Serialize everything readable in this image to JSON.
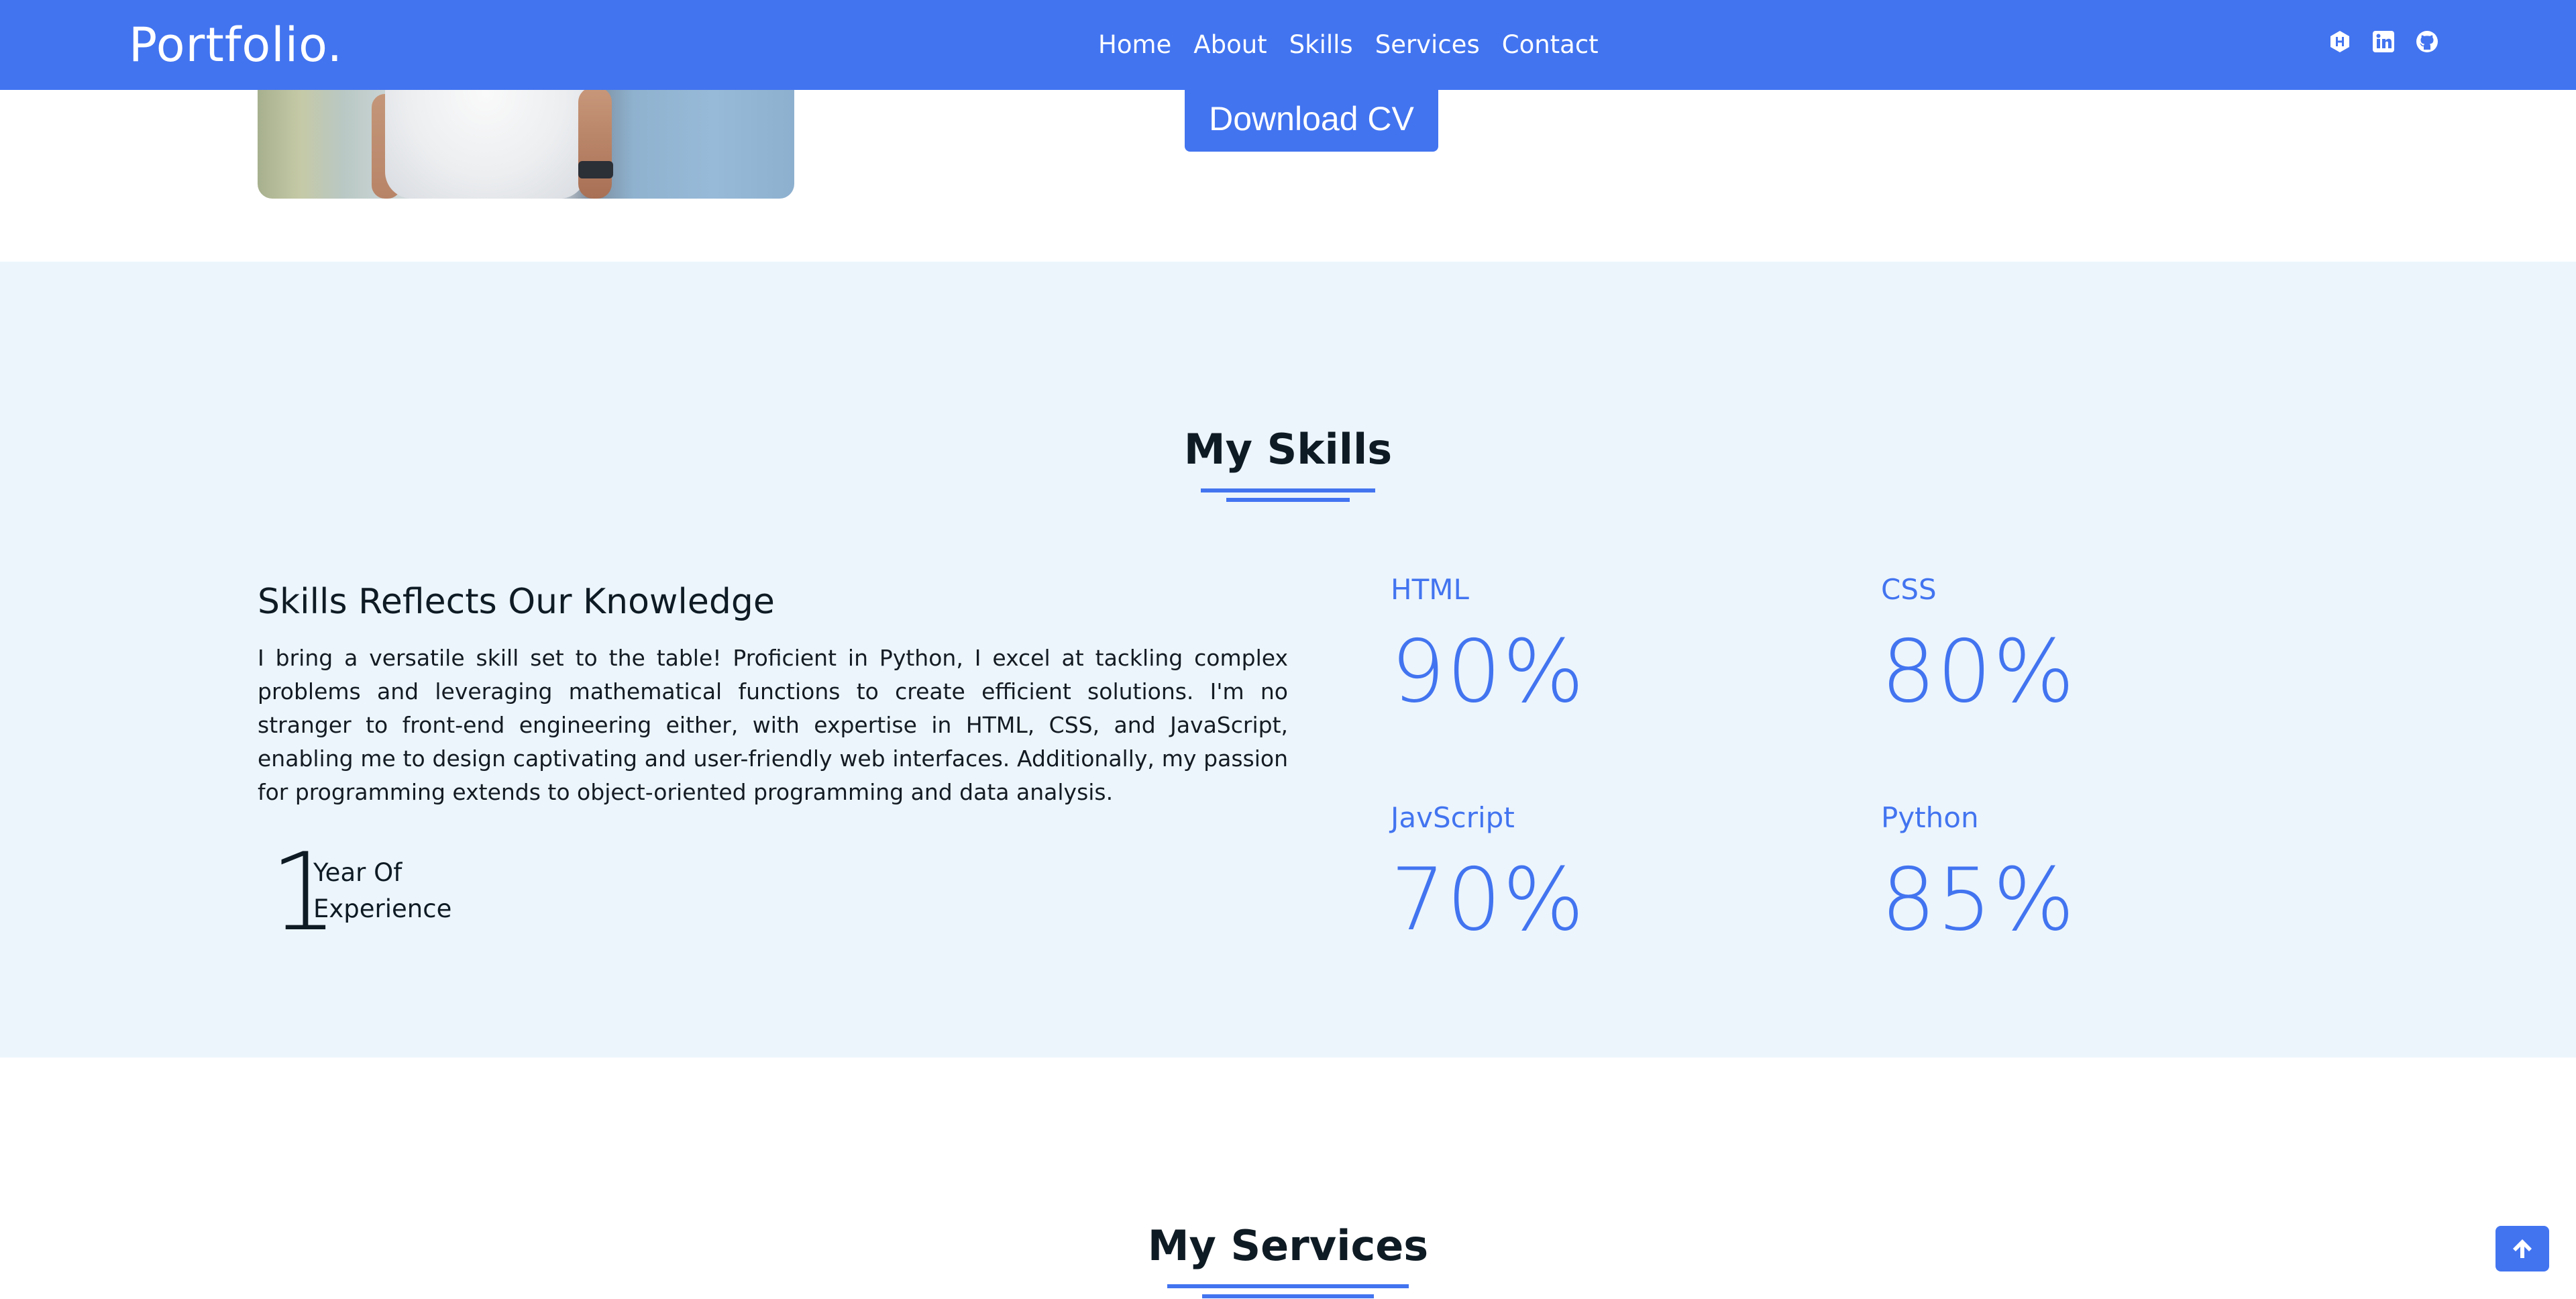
{
  "colors": {
    "brand": "#4274f0",
    "skills_bg": "#ecf5fc",
    "text_dark": "#0f1b24"
  },
  "navbar": {
    "brand": "Portfolio.",
    "links": [
      {
        "label": "Home"
      },
      {
        "label": "About"
      },
      {
        "label": "Skills"
      },
      {
        "label": "Services"
      },
      {
        "label": "Contact"
      }
    ],
    "social_icons": [
      "hashnode-icon",
      "linkedin-icon",
      "github-icon"
    ]
  },
  "hero": {
    "download_label": "Download CV"
  },
  "skills": {
    "title": "My Skills",
    "heading": "Skills Reflects Our Knowledge",
    "description": "I bring a versatile skill set to the table! Proficient in Python, I excel at tackling complex problems and leveraging mathematical functions to create efficient solutions. I'm no stranger to front-end engineering either, with expertise in HTML, CSS, and JavaScript, enabling me to design captivating and user-friendly web interfaces. Additionally, my passion for programming extends to object-oriented programming and data analysis.",
    "experience": {
      "number": "1",
      "label": "Year Of Experience"
    },
    "items": [
      {
        "name": "HTML",
        "percent": "90%"
      },
      {
        "name": "CSS",
        "percent": "80%"
      },
      {
        "name": "JavScript",
        "percent": "70%"
      },
      {
        "name": "Python",
        "percent": "85%"
      }
    ]
  },
  "services": {
    "title": "My Services"
  },
  "back_to_top_icon": "arrow-up-icon"
}
